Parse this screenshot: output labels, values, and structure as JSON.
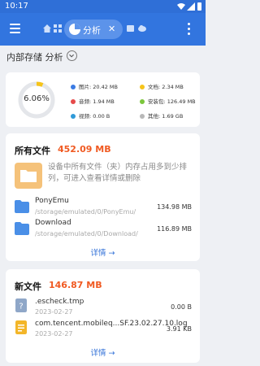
{
  "status": {
    "time": "10:17"
  },
  "tabs": {
    "active_label": "分析",
    "close_symbol": "✕"
  },
  "breadcrumb": {
    "label": "内部存储 分析"
  },
  "storage": {
    "percent_label": "6.06%",
    "percent_value": 6.06,
    "legend": [
      {
        "label": "图片: 20.42 MB",
        "color": "#3b7be3"
      },
      {
        "label": "文档: 2.34 MB",
        "color": "#f6c41a"
      },
      {
        "label": "音频: 1.94 MB",
        "color": "#e64a4a"
      },
      {
        "label": "安装包: 126.49 MB",
        "color": "#7bc63c"
      },
      {
        "label": "视频: 0.00 B",
        "color": "#2f9ad8"
      },
      {
        "label": "其他: 1.69 GB",
        "color": "#b8b8b8"
      }
    ]
  },
  "all_files": {
    "title": "所有文件",
    "size": "452.09 MB",
    "tip": "设备中所有文件（夹）内存占用多到少排列，可进入查看详情或删除",
    "items": [
      {
        "name": "PonyEmu",
        "path": "/storage/emulated/0/PonyEmu/",
        "size": "134.98 MB"
      },
      {
        "name": "Download",
        "path": "/storage/emulated/0/Download/",
        "size": "116.89 MB"
      }
    ],
    "detail_label": "详情 →"
  },
  "new_files": {
    "title": "新文件",
    "size": "146.87 MB",
    "items": [
      {
        "name": ".escheck.tmp",
        "date": "2023-02-27",
        "size": "0.00 B",
        "icon": "unknown-file-icon"
      },
      {
        "name": "com.tencent.mobileq...SF.23.02.27.10.log",
        "date": "2023-02-27",
        "size": "3.91 KB",
        "icon": "log-file-icon"
      }
    ],
    "detail_label": "详情 →"
  }
}
